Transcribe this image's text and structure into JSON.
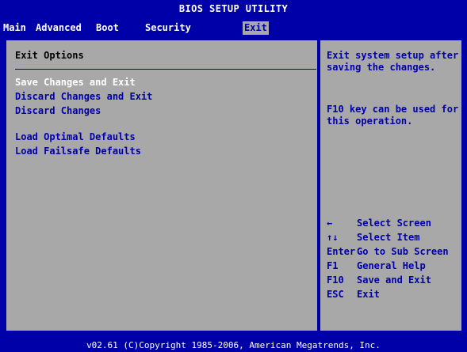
{
  "header": {
    "title": "BIOS SETUP UTILITY"
  },
  "menu": [
    {
      "label": "Main"
    },
    {
      "label": "Advanced"
    },
    {
      "label": "Boot"
    },
    {
      "label": "Security"
    },
    {
      "label": "Exit"
    }
  ],
  "exit": {
    "section_title": "Exit Options",
    "options": [
      {
        "label": "Save Changes and Exit",
        "selected": true
      },
      {
        "label": "Discard Changes and Exit",
        "selected": false
      },
      {
        "label": "Discard Changes",
        "selected": false
      },
      {
        "label": "Load Optimal Defaults",
        "selected": false
      },
      {
        "label": "Load Failsafe Defaults",
        "selected": false
      }
    ]
  },
  "help": {
    "text1": "Exit system setup after saving the changes.",
    "text2": "F10 key can be used for this operation."
  },
  "legend": [
    {
      "key": "←",
      "desc": "Select Screen"
    },
    {
      "key": "↑↓",
      "desc": "Select Item"
    },
    {
      "key": "Enter",
      "desc": "Go to Sub Screen"
    },
    {
      "key": "F1",
      "desc": "General Help"
    },
    {
      "key": "F10",
      "desc": "Save and Exit"
    },
    {
      "key": "ESC",
      "desc": "Exit"
    }
  ],
  "footer": "v02.61 (C)Copyright 1985-2006, American Megatrends, Inc.",
  "colors": {
    "background": "#0000a8",
    "panel": "#a8a8a8",
    "text_primary": "#0000a8",
    "text_inverse": "#ffffff"
  }
}
